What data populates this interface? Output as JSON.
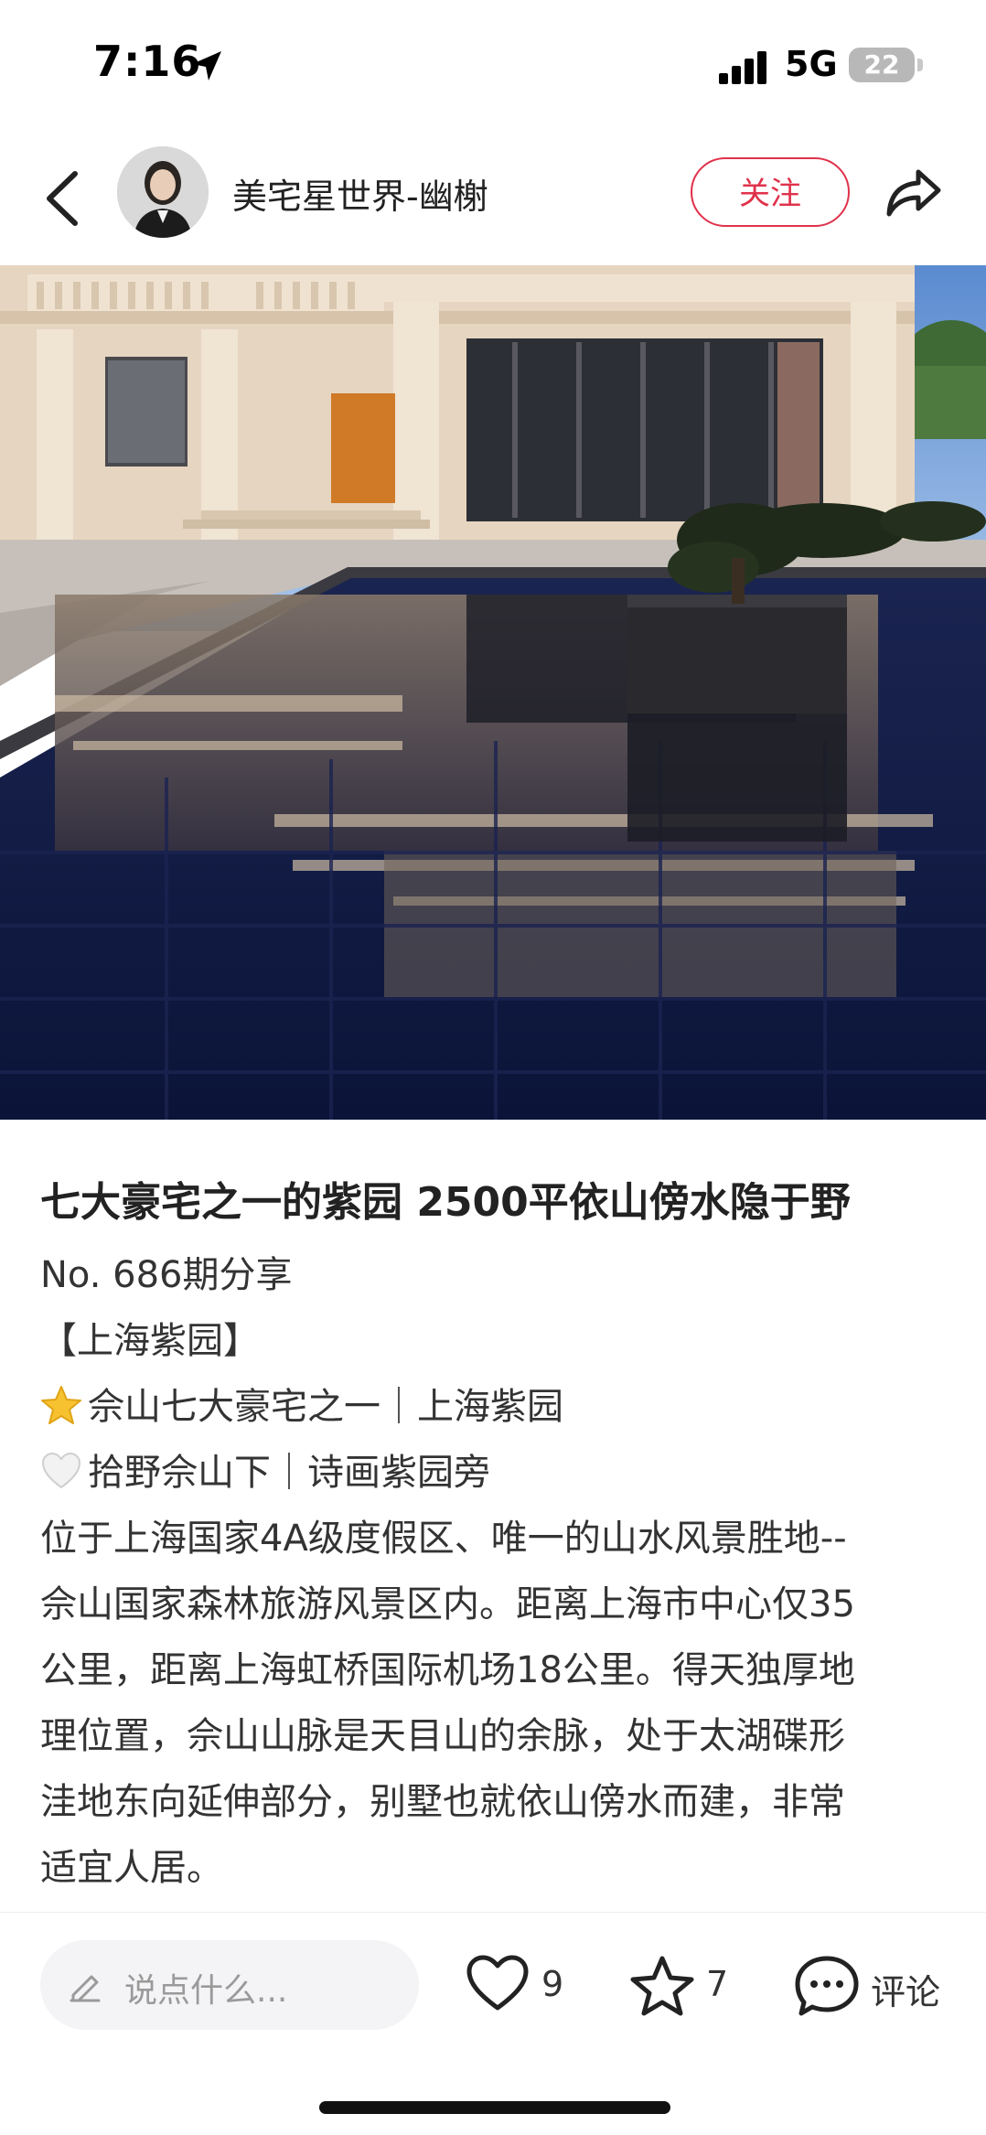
{
  "status_bar": {
    "time": "7:16",
    "network": "5G",
    "battery": "22"
  },
  "header": {
    "author_name": "美宅星世界-幽榭",
    "follow_label": "关注"
  },
  "post": {
    "title": "七大豪宅之一的紫园 2500平依山傍水隐于野",
    "issue": "No. 686期分享",
    "bracket_title": "【上海紫园】",
    "highlight_1": "佘山七大豪宅之一｜上海紫园",
    "highlight_2": "拾野佘山下｜诗画紫园旁",
    "body_lines": [
      "位于上海国家4A级度假区、唯一的山水风景胜地--",
      "佘山国家森林旅游风景区内。距离上海市中心仅35",
      "公里，距离上海虹桥国际机场18公里。得天独厚地",
      "理位置，佘山山脉是天目山的余脉，处于太湖碟形",
      "洼地东向延伸部分，别墅也就依山傍水而建，非常",
      "适宜人居。"
    ]
  },
  "bottom_bar": {
    "comment_placeholder": "说点什么...",
    "like_count": "9",
    "collect_count": "7",
    "comment_label": "评论"
  },
  "colors": {
    "accent": "#e0324b",
    "sky": "#6b9ad6",
    "villa": "#e6d5c0",
    "water": "#0f1a40"
  },
  "icons": {
    "back": "chevron-left-icon",
    "share": "share-arrow-icon",
    "pencil": "pencil-icon",
    "like": "heart-icon",
    "collect": "star-icon",
    "comment": "chat-bubble-icon",
    "emoji_1": "star-emoji-icon",
    "emoji_2": "white-heart-emoji-icon"
  }
}
